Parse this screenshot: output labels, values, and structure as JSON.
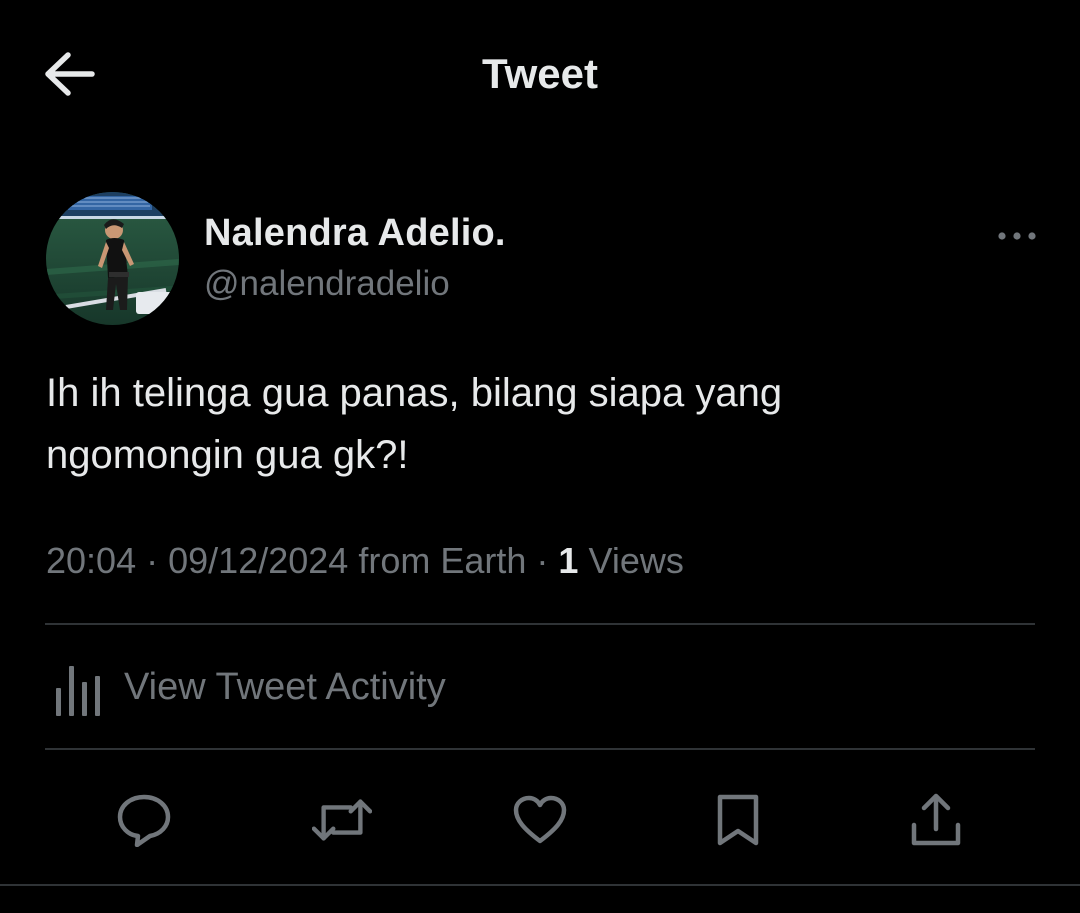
{
  "header": {
    "title": "Tweet",
    "back_icon": "arrow-left-icon"
  },
  "author": {
    "display_name": "Nalendra Adelio.",
    "handle": "@nalendradelio",
    "avatar": "profile-photo"
  },
  "tweet": {
    "text_line_1": "Ih ih telinga gua panas, bilang siapa yang",
    "text_line_2": "ngomongin gua gk?!"
  },
  "meta": {
    "time": "20:04",
    "separator": "·",
    "date": "09/12/2024",
    "source": "from Earth",
    "views_count": "1",
    "views_label": "Views"
  },
  "activity": {
    "label": "View Tweet Activity",
    "icon": "bar-chart-icon"
  },
  "actions": [
    {
      "name": "reply",
      "icon": "reply-icon"
    },
    {
      "name": "retweet",
      "icon": "retweet-icon"
    },
    {
      "name": "like",
      "icon": "heart-icon"
    },
    {
      "name": "bookmark",
      "icon": "bookmark-icon"
    },
    {
      "name": "share",
      "icon": "share-icon"
    }
  ],
  "colors": {
    "background": "#000000",
    "primary_text": "#e7e9ea",
    "secondary_text": "#71767b",
    "divider": "#2f3336"
  }
}
